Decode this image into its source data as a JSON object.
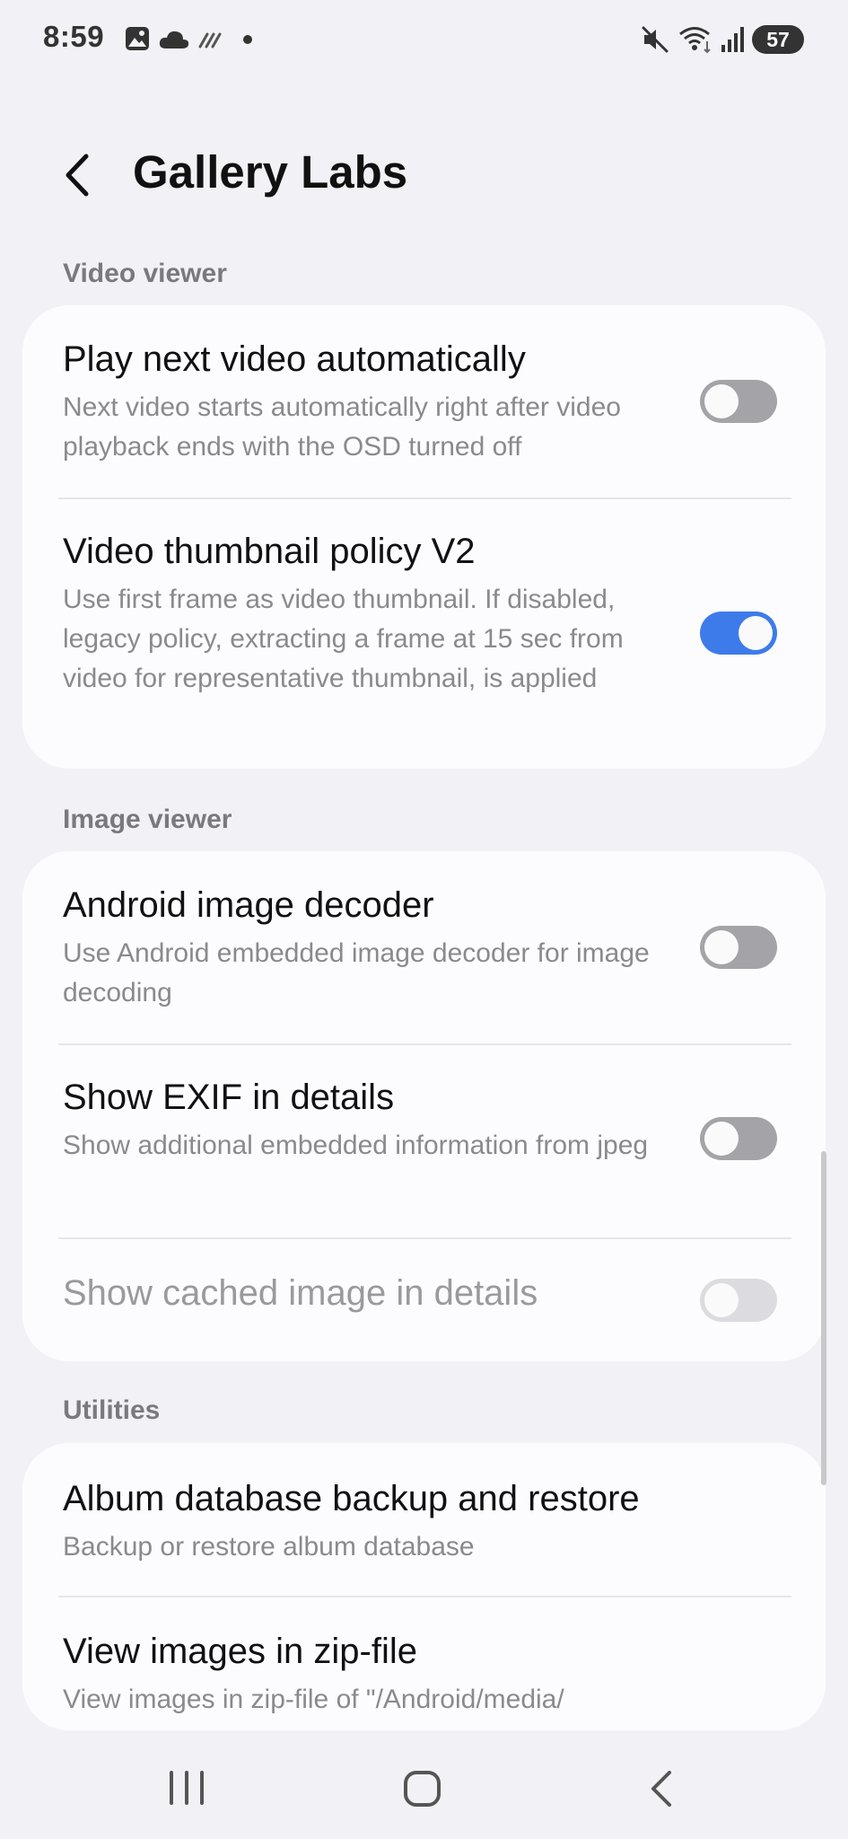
{
  "status_bar": {
    "time": "8:59",
    "battery": "57",
    "left_icons": [
      "gallery-icon",
      "cloud-icon",
      "data-sync-icon",
      "dot-icon"
    ],
    "right_icons": [
      "mute-icon",
      "wifi-icon",
      "signal-icon",
      "battery-icon"
    ]
  },
  "header": {
    "title": "Gallery Labs",
    "back_icon": "chevron-left-icon"
  },
  "sections": {
    "video": {
      "header": "Video viewer",
      "items": [
        {
          "title": "Play next video automatically",
          "subtitle": "Next video starts automatically right after video playback ends with the OSD turned off",
          "enabled": false
        },
        {
          "title": "Video thumbnail policy V2",
          "subtitle": "Use first frame as video thumbnail. If disabled, legacy policy, extracting a frame at 15 sec from video for representative thumbnail, is applied",
          "enabled": true
        }
      ]
    },
    "image": {
      "header": "Image viewer",
      "items": [
        {
          "title": "Android image decoder",
          "subtitle": "Use Android embedded image decoder for image decoding",
          "enabled": false
        },
        {
          "title": "Show EXIF in details",
          "subtitle": "Show additional embedded information from jpeg",
          "enabled": false
        },
        {
          "title": "Show cached image in details",
          "enabled": false,
          "disabled": true
        }
      ]
    },
    "utilities": {
      "header": "Utilities",
      "items": [
        {
          "title": "Album database backup and restore",
          "subtitle": "Backup or restore album database"
        },
        {
          "title": "View images in zip-file",
          "subtitle": "View images in zip-file of \"/Android/media/"
        }
      ]
    }
  },
  "nav_bar": {
    "icons": [
      "recent-apps-icon",
      "home-icon",
      "back-icon"
    ]
  },
  "colors": {
    "background": "#f2f2f6",
    "card": "#fcfcff",
    "toggle_on": "#3e7bea",
    "toggle_off": "#a3a3a8",
    "toggle_disabled": "#dcdce0"
  }
}
